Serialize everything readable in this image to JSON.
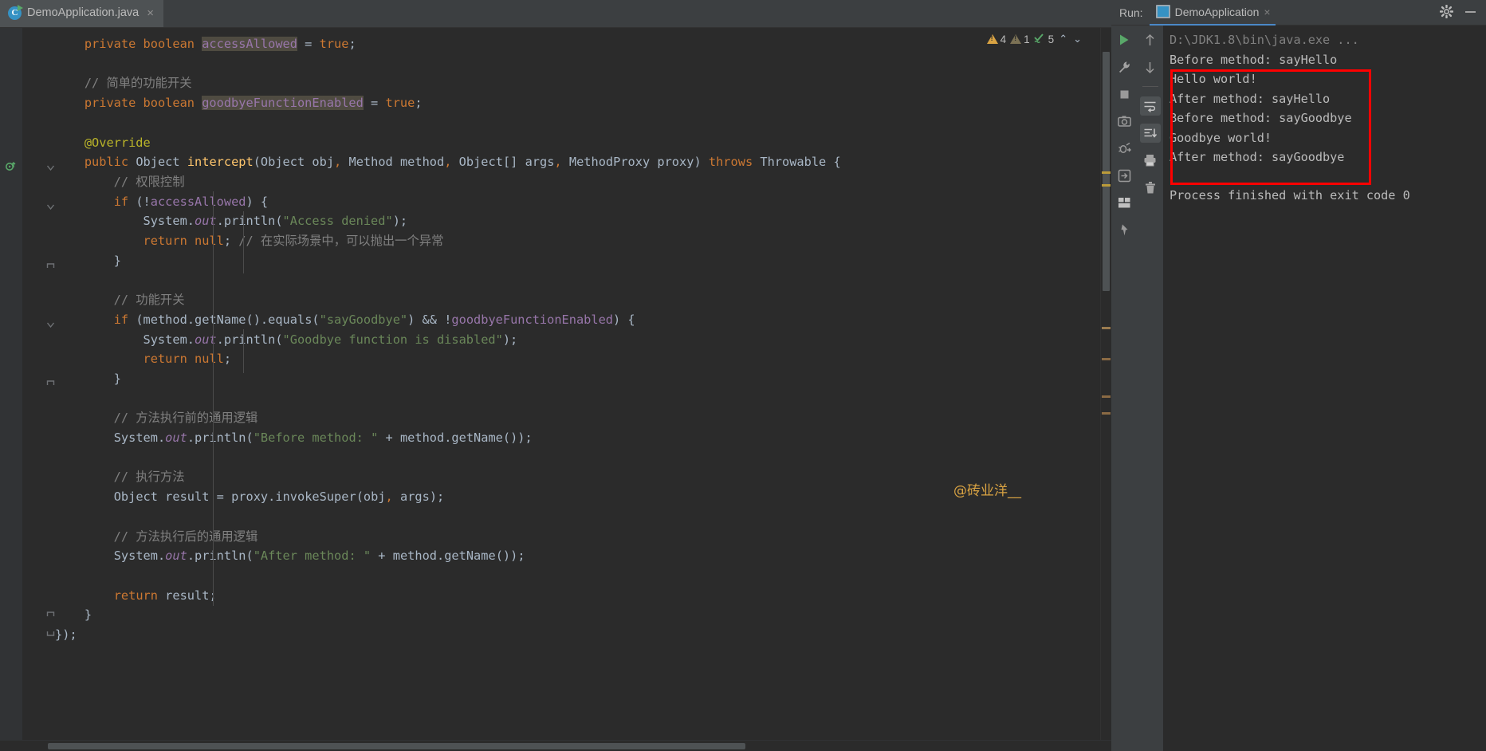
{
  "editor": {
    "tab": {
      "filename": "DemoApplication.java",
      "icon": "java-class-icon",
      "close": "×"
    },
    "inspections": {
      "warnings_count": "4",
      "weak_warnings_count": "1",
      "checks_count": "5",
      "prev_label": "⌃",
      "next_label": "⌄"
    },
    "watermark": "@砖业洋__",
    "code_lines": [
      "    private boolean accessAllowed = true;",
      "",
      "    // 简单的功能开关",
      "    private boolean goodbyeFunctionEnabled = true;",
      "",
      "    @Override",
      "    public Object intercept(Object obj, Method method, Object[] args, MethodProxy proxy) throws Throwable {",
      "        // 权限控制",
      "        if (!accessAllowed) {",
      "            System.out.println(\"Access denied\");",
      "            return null; // 在实际场景中，可以抛出一个异常",
      "        }",
      "",
      "        // 功能开关",
      "        if (method.getName().equals(\"sayGoodbye\") && !goodbyeFunctionEnabled) {",
      "            System.out.println(\"Goodbye function is disabled\");",
      "            return null;",
      "        }",
      "",
      "        // 方法执行前的通用逻辑",
      "        System.out.println(\"Before method: \" + method.getName());",
      "",
      "        // 执行方法",
      "        Object result = proxy.invokeSuper(obj, args);",
      "",
      "        // 方法执行后的通用逻辑",
      "        System.out.println(\"After method: \" + method.getName());",
      "",
      "        return result;",
      "    }",
      "});"
    ]
  },
  "run_panel": {
    "label": "Run:",
    "tab_title": "DemoApplication",
    "tab_close": "×",
    "gear_icon": "settings-gear-icon",
    "minimize_icon": "minimize-icon",
    "toolbar_primary": [
      {
        "name": "rerun-button",
        "glyph": "▶"
      },
      {
        "name": "debug-wrench-button",
        "glyph": "wrench"
      },
      {
        "name": "stop-button",
        "glyph": "■"
      },
      {
        "name": "screenshot-button",
        "glyph": "camera"
      },
      {
        "name": "debug-attach-button",
        "glyph": "bug"
      },
      {
        "name": "export-button",
        "glyph": "export"
      },
      {
        "name": "layout-button",
        "glyph": "layout"
      },
      {
        "name": "pin-button",
        "glyph": "pin"
      }
    ],
    "toolbar_secondary": [
      {
        "name": "up-button",
        "glyph": "↑"
      },
      {
        "name": "down-button",
        "glyph": "↓"
      },
      {
        "name": "soft-wrap-button",
        "glyph": "wrap"
      },
      {
        "name": "scroll-to-end-button",
        "glyph": "scroll-end"
      },
      {
        "name": "print-button",
        "glyph": "printer"
      },
      {
        "name": "clear-all-button",
        "glyph": "trash"
      }
    ],
    "console": {
      "command_line": "D:\\JDK1.8\\bin\\java.exe ...",
      "highlighted_output": [
        "Before method: sayHello",
        "Hello world!",
        "After method: sayHello",
        "Before method: sayGoodbye",
        "Goodbye world!",
        "After method: sayGoodbye"
      ],
      "exit_line": "Process finished with exit code 0"
    }
  },
  "colors": {
    "editor_bg": "#2b2b2b",
    "panel_bg": "#3c3f41",
    "keyword": "#cc7832",
    "string": "#6a8759",
    "comment": "#808080",
    "field": "#9876aa",
    "method": "#ffc66d",
    "annotation": "#bbb529",
    "highlight_box": "#ff0000",
    "watermark": "#d9a343",
    "accent_tab": "#4a88c7"
  }
}
